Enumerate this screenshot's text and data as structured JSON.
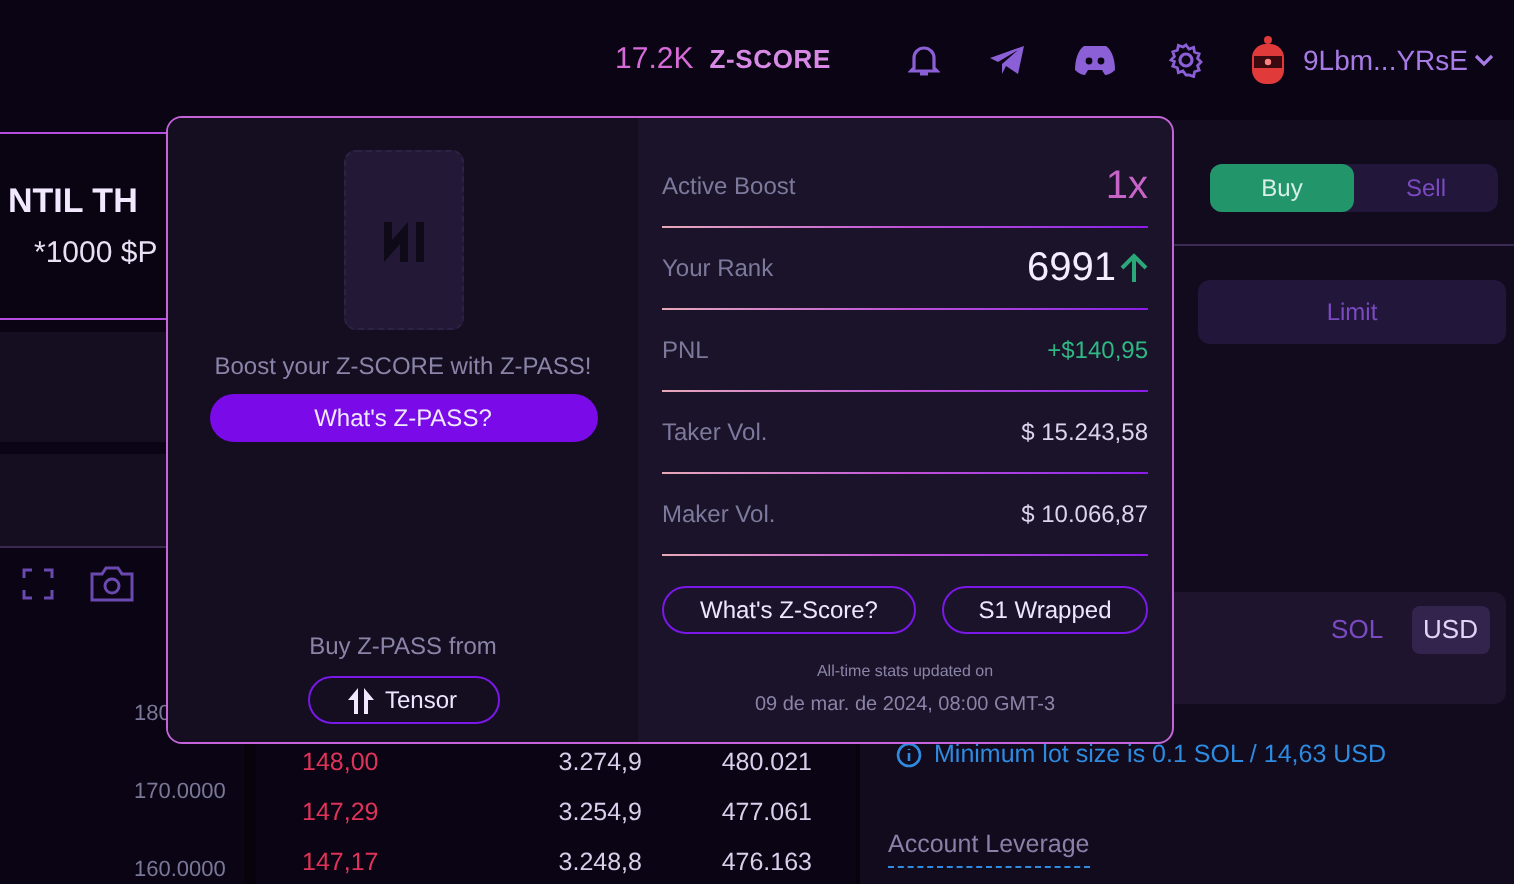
{
  "header": {
    "score_value": "17.2K",
    "score_label": "Z-SCORE",
    "wallet": "9Lbm...YRsE"
  },
  "banner": {
    "title": "NTIL TH",
    "subtitle": "*1000 $P"
  },
  "chart": {
    "price_labels": [
      "180",
      "170.0000",
      "160.0000"
    ]
  },
  "order_book": {
    "rows": [
      {
        "price": "148,00",
        "size": "3.274,9",
        "total": "480.021"
      },
      {
        "price": "147,29",
        "size": "3.254,9",
        "total": "477.061"
      },
      {
        "price": "147,17",
        "size": "3.248,8",
        "total": "476.163"
      }
    ]
  },
  "order_form": {
    "sides": [
      {
        "label": "Buy",
        "selected": true
      },
      {
        "label": "Sell",
        "selected": false
      }
    ],
    "order_types": [
      {
        "label": "Limit",
        "selected": false
      }
    ],
    "units": [
      {
        "label": "SOL",
        "selected": false
      },
      {
        "label": "USD",
        "selected": true
      }
    ],
    "notice": "Minimum lot size is 0.1 SOL / 14,63 USD",
    "leverage_label": "Account Leverage"
  },
  "zpass_popup": {
    "boost_text": "Boost your Z-SCORE with Z-PASS!",
    "zpass_button": "What's Z-PASS?",
    "buy_from": "Buy Z-PASS from",
    "tensor_button": "Tensor",
    "stats": [
      {
        "label": "Active Boost",
        "value": "1x",
        "kind": "boost"
      },
      {
        "label": "Your Rank",
        "value": "6991",
        "kind": "rank"
      },
      {
        "label": "PNL",
        "value": "+$140,95",
        "kind": "pnl"
      },
      {
        "label": "Taker Vol.",
        "value": "$ 15.243,58",
        "kind": "plain"
      },
      {
        "label": "Maker Vol.",
        "value": "$ 10.066,87",
        "kind": "plain"
      }
    ],
    "buttons": [
      "What's Z-Score?",
      "S1 Wrapped"
    ],
    "footer": [
      "All-time stats updated on",
      "09 de mar. de 2024, 08:00 GMT-3"
    ]
  }
}
